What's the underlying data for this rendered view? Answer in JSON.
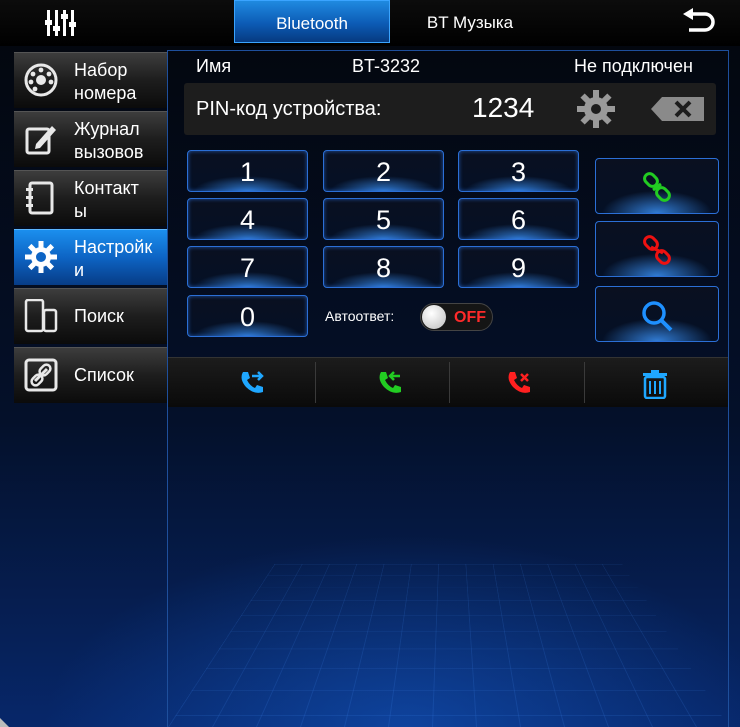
{
  "header": {
    "tabs": [
      {
        "label": "Bluetooth",
        "active": true
      },
      {
        "label": "BT Музыка",
        "active": false
      }
    ],
    "left_icon": "equalizer-icon",
    "right_icon": "back-arrow-icon"
  },
  "sidebar": {
    "items": [
      {
        "label": "Набор\nномера",
        "icon": "dial-icon",
        "active": false
      },
      {
        "label": "Журнал\nвызовов",
        "icon": "call-log-icon",
        "active": false
      },
      {
        "label": "Контакт\nы",
        "icon": "contacts-icon",
        "active": false
      },
      {
        "label": "Настройк\nи",
        "icon": "settings-gear-icon",
        "active": true
      },
      {
        "label": "Поиск",
        "icon": "devices-icon",
        "active": false
      },
      {
        "label": "Список",
        "icon": "link-icon",
        "active": false
      }
    ]
  },
  "device": {
    "name_label": "Имя",
    "name_value": "BT-3232",
    "status": "Не подключен"
  },
  "pin": {
    "label": "PIN-код устройства:",
    "value": "1234"
  },
  "keypad": [
    "1",
    "2",
    "3",
    "4",
    "5",
    "6",
    "7",
    "8",
    "9",
    "0"
  ],
  "autoanswer": {
    "label": "Автоответ:",
    "state": "OFF"
  },
  "actions": [
    {
      "name": "connect-icon",
      "color": "#22cc22"
    },
    {
      "name": "disconnect-icon",
      "color": "#ee1111"
    },
    {
      "name": "search-icon",
      "color": "#1e90ff"
    }
  ],
  "call_bar": [
    {
      "name": "transfer-call-icon",
      "color": "#1fa7ff"
    },
    {
      "name": "answer-call-icon",
      "color": "#22cc22"
    },
    {
      "name": "reject-call-icon",
      "color": "#ff2020"
    },
    {
      "name": "delete-trash-icon",
      "color": "#1fa7ff"
    }
  ],
  "colors": {
    "accent": "#1e8ae8",
    "background": "#02060f"
  }
}
